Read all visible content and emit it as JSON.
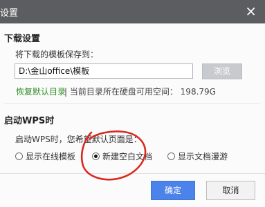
{
  "dialog": {
    "title": "设置",
    "close_glyph": "×"
  },
  "download": {
    "section_title": "下载设置",
    "save_to_label": "将下载的模板保存到：",
    "path_value": "D:\\金山office\\模板",
    "browse_label": "浏览",
    "restore_link": "恢复默认目录",
    "space_info": "| 当前目录所在硬盘可用空间： 198.79G"
  },
  "startup": {
    "section_title": "启动WPS时",
    "prompt": "启动WPS时，您希望默认页面是：",
    "options": [
      {
        "label": "显示在线模板",
        "checked": false
      },
      {
        "label": "新建空白文档",
        "checked": true
      },
      {
        "label": "显示文档漫游",
        "checked": false
      }
    ]
  },
  "footer": {
    "ok_label": "确定",
    "cancel_label": "取消"
  },
  "colors": {
    "link": "#2f8f25",
    "primary": "#4b83ea",
    "annotation": "#d9281f",
    "titlebar": "#5b5d60"
  }
}
